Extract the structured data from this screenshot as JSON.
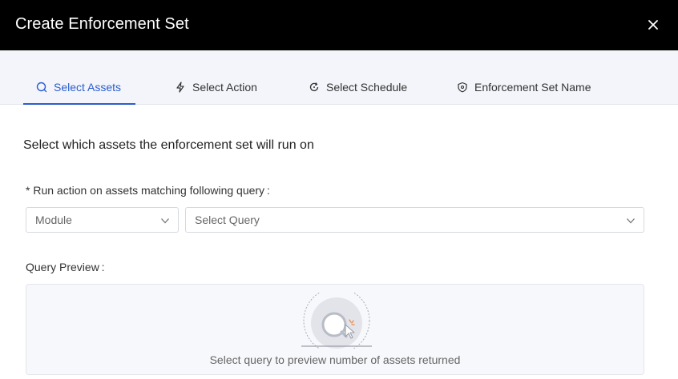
{
  "header": {
    "title": "Create Enforcement Set",
    "close_icon": "close-icon"
  },
  "tabs": [
    {
      "label": "Select Assets",
      "icon": "search-icon",
      "active": true
    },
    {
      "label": "Select Action",
      "icon": "lightning-icon",
      "active": false
    },
    {
      "label": "Select Schedule",
      "icon": "refresh-icon",
      "active": false
    },
    {
      "label": "Enforcement Set Name",
      "icon": "shield-icon",
      "active": false
    }
  ],
  "main": {
    "heading": "Select which assets the enforcement set will run on",
    "query_label": "* Run action on assets matching following query :",
    "module_select": {
      "value": "Module"
    },
    "query_select": {
      "value": "Select Query"
    },
    "preview_label": "Query Preview :",
    "preview_empty_text": "Select query to preview number of assets returned"
  },
  "colors": {
    "header_bg": "#000000",
    "accent": "#2a5dd0",
    "tabs_bg": "#f3f5fa"
  }
}
